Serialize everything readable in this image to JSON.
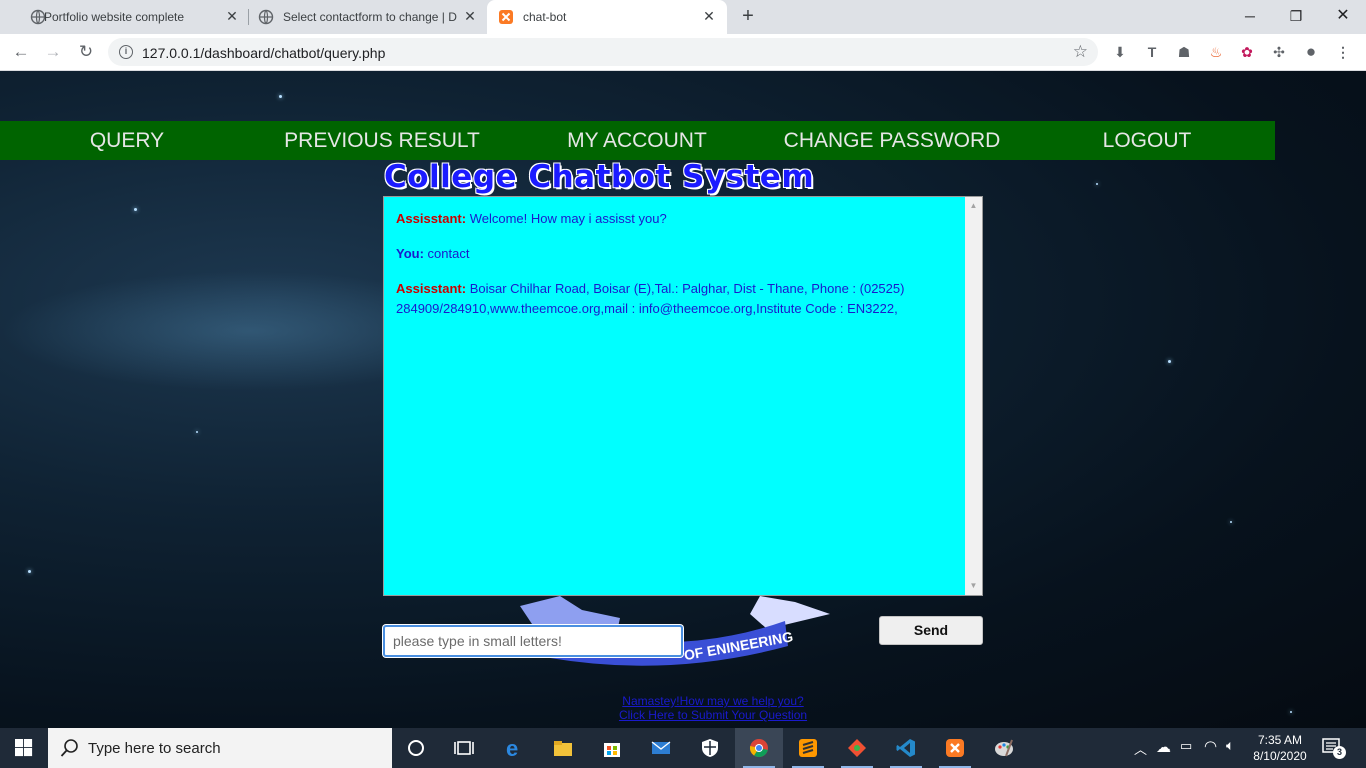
{
  "browser": {
    "tabs": [
      {
        "title": "Portfolio website complete",
        "active": false
      },
      {
        "title": "Select contactform to change | D",
        "active": false
      },
      {
        "title": "chat-bot",
        "active": true
      }
    ],
    "new_tab": "+",
    "url": "127.0.0.1/dashboard/chatbot/query.php"
  },
  "nav": {
    "items": [
      "QUERY",
      "PREVIOUS RESULT",
      "MY ACCOUNT",
      "CHANGE PASSWORD",
      "LOGOUT"
    ]
  },
  "title": "College Chatbot System",
  "chat": {
    "messages": [
      {
        "speaker": "Assisstant:",
        "text": "Welcome! How may i assisst you?"
      },
      {
        "speaker": "You:",
        "text": "contact"
      },
      {
        "speaker": "Assisstant:",
        "text": "Boisar Chilhar Road, Boisar (E),Tal.: Palghar, Dist - Thane, Phone : (02525) 284909/284910,www.theemcoe.org,mail : info@theemcoe.org,Institute Code : EN3222,"
      }
    ],
    "input_placeholder": "please type in small letters!",
    "send_label": "Send"
  },
  "banner_text": "OF ENINEERING",
  "footer": {
    "line1": "Namastey!How may we help you?",
    "line2": "Click Here to Submit Your Question"
  },
  "taskbar": {
    "search_placeholder": "Type here to search",
    "time": "7:35 AM",
    "date": "8/10/2020",
    "notification_count": "3"
  },
  "colors": {
    "menu_bg": "#006400",
    "chat_bg": "#00ffff",
    "title": "#1b1bff",
    "assistant_label": "#cc0000",
    "chat_text": "#1a1acc"
  }
}
